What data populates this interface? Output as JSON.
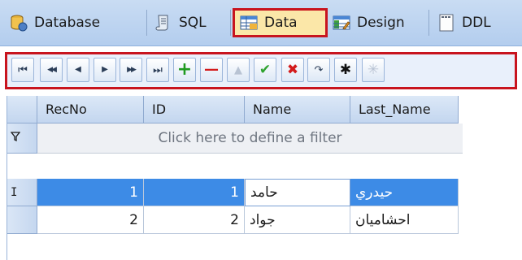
{
  "tabs": [
    {
      "label": "Database",
      "icon": "database-icon",
      "active": false
    },
    {
      "label": "SQL",
      "icon": "sql-scroll-icon",
      "active": false
    },
    {
      "label": "Data",
      "icon": "data-grid-icon",
      "active": true
    },
    {
      "label": "Design",
      "icon": "design-table-icon",
      "active": false
    },
    {
      "label": "DDL",
      "icon": "ddl-document-icon",
      "active": false
    }
  ],
  "navigator": {
    "buttons": [
      {
        "name": "first-record-button",
        "glyph": "⏮",
        "color": "#2b3d57"
      },
      {
        "name": "prior-page-button",
        "glyph": "◀◀",
        "color": "#2b3d57"
      },
      {
        "name": "prior-record-button",
        "glyph": "◀",
        "color": "#2b3d57"
      },
      {
        "name": "next-record-button",
        "glyph": "▶",
        "color": "#2b3d57"
      },
      {
        "name": "next-page-button",
        "glyph": "▶▶",
        "color": "#2b3d57"
      },
      {
        "name": "last-record-button",
        "glyph": "⏭",
        "color": "#2b3d57"
      },
      {
        "name": "insert-record-button",
        "glyph": "+",
        "color": "#1f9a1f"
      },
      {
        "name": "delete-record-button",
        "glyph": "—",
        "color": "#d31b1b"
      },
      {
        "name": "edit-record-button",
        "glyph": "▲",
        "color": "#b8c3d3"
      },
      {
        "name": "post-edit-button",
        "glyph": "✔",
        "color": "#2fa32f"
      },
      {
        "name": "cancel-edit-button",
        "glyph": "✖",
        "color": "#d31b1b"
      },
      {
        "name": "refresh-button",
        "glyph": "↷",
        "color": "#2b3d57"
      },
      {
        "name": "bookmark-button",
        "glyph": "✱",
        "color": "#111111"
      },
      {
        "name": "goto-bookmark-button",
        "glyph": "✳",
        "color": "#b8c3d3"
      }
    ]
  },
  "grid": {
    "columns": [
      "RecNo",
      "ID",
      "Name",
      "Last_Name"
    ],
    "filter_prompt": "Click here to define a filter",
    "filter_indicator": "filter-funnel-icon",
    "current_row_indicator": "I",
    "rows": [
      {
        "recno": "1",
        "id": "1",
        "name": "حامد",
        "last_name": "حيدري",
        "selected": true
      },
      {
        "recno": "2",
        "id": "2",
        "name": "جواد",
        "last_name": "احشامیان",
        "selected": false
      }
    ]
  },
  "colors": {
    "highlight_border": "#c8141e",
    "selection": "#3d8be6"
  }
}
